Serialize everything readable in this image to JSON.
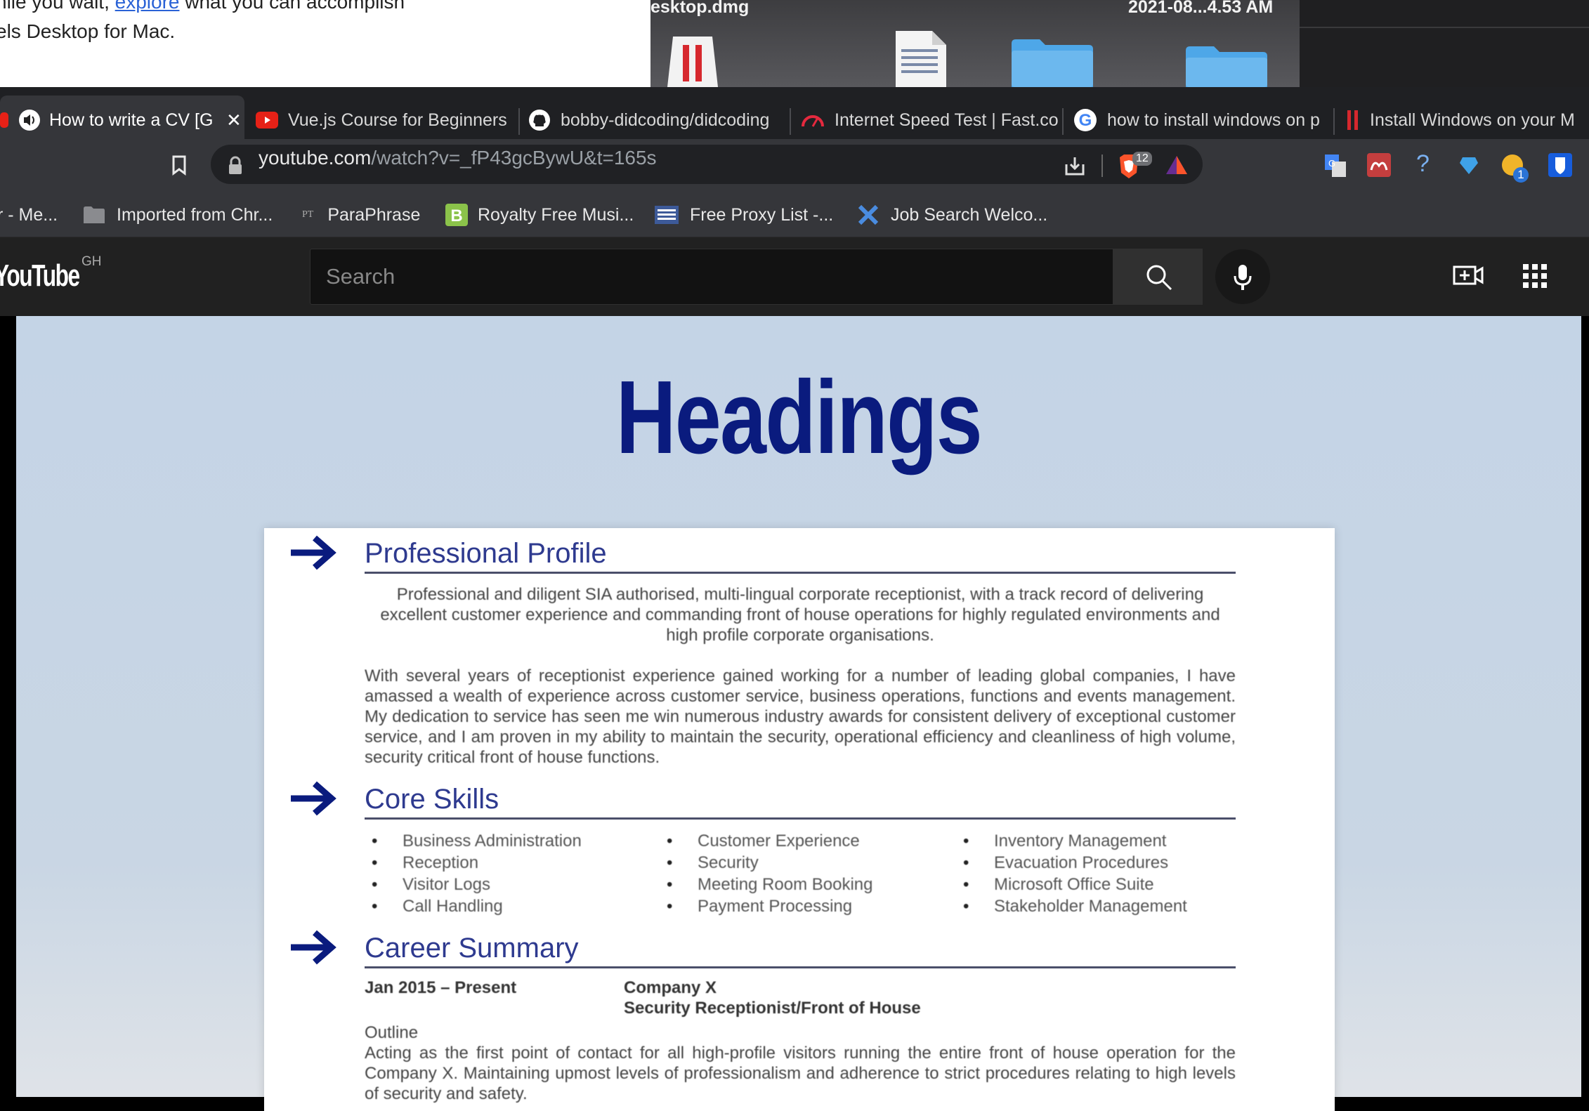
{
  "background_window": {
    "line1_pre": "hile you wait, ",
    "line1_link": "explore",
    "line1_post": " what you can accomplish",
    "line2": "els Desktop for Mac."
  },
  "finder": {
    "file_name": "esktop.dmg",
    "file_date": "2021-08...4.53 AM"
  },
  "tabs": [
    {
      "title": "How to write a CV [G",
      "active": true,
      "close": "✕"
    },
    {
      "title": "Vue.js Course for Beginners"
    },
    {
      "title": "bobby-didcoding/didcoding"
    },
    {
      "title": "Internet Speed Test | Fast.co"
    },
    {
      "title": "how to install windows on p"
    },
    {
      "title": "Install Windows on your M"
    }
  ],
  "address": {
    "domain": "youtube.com",
    "path": "/watch?v=_fP43gcBywU&t=165s",
    "brave_badge": "12",
    "ext_badge": "1"
  },
  "bookmarks": [
    {
      "label": "r - Me..."
    },
    {
      "label": "Imported from Chr..."
    },
    {
      "label": "ParaPhrase",
      "icon_text": "PT"
    },
    {
      "label": "Royalty Free Musi..."
    },
    {
      "label": "Free Proxy List -..."
    },
    {
      "label": "Job Search Welco..."
    }
  ],
  "youtube": {
    "logo": "YouTube",
    "country": "GH",
    "search_placeholder": "Search"
  },
  "video": {
    "heading": "Headings",
    "sections": {
      "profile_title": "Professional Profile",
      "profile_p1": "Professional and diligent SIA authorised, multi-lingual corporate receptionist, with a track record of delivering excellent customer experience and commanding front of house operations for highly regulated environments and high profile corporate organisations.",
      "profile_p2": "With several years of receptionist experience gained working for a number of leading global companies, I have amassed a wealth of experience across customer service, business operations, functions and events management. My dedication to service has seen me win numerous industry awards for consistent delivery of exceptional customer service, and I am proven in my ability to maintain the security, operational efficiency and cleanliness of high volume, security critical front of house functions.",
      "skills_title": "Core Skills",
      "skills_col1": [
        "Business Administration",
        "Reception",
        "Visitor Logs",
        "Call Handling"
      ],
      "skills_col2": [
        "Customer Experience",
        "Security",
        "Meeting Room Booking",
        "Payment Processing"
      ],
      "skills_col3": [
        "Inventory Management",
        "Evacuation Procedures",
        "Microsoft Office Suite",
        "Stakeholder Management"
      ],
      "career_title": "Career Summary",
      "career_date": "Jan 2015 – Present",
      "career_company": "Company X",
      "career_role": "Security Receptionist/Front of House",
      "career_outline_label": "Outline",
      "career_outline": "Acting as the first point of contact for all high-profile visitors running the entire front of house operation for the Company X. Maintaining upmost levels of professionalism and adherence to strict procedures relating to high levels of security and safety."
    }
  },
  "colors": {
    "heading": "#0a1b7e",
    "section_title": "#2e3a8f",
    "video_bg": "#c4d4e6"
  }
}
